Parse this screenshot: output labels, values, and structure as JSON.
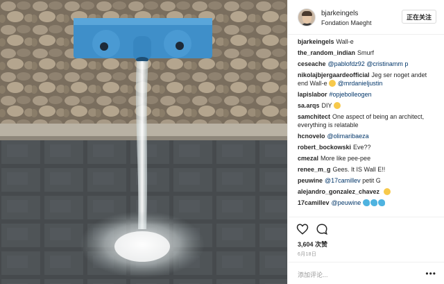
{
  "post_header": {
    "username": "bjarkeingels",
    "location": "Fondation Maeght",
    "follow_label": "正在关注"
  },
  "comments": [
    {
      "user": "bjarkeingels",
      "text": "Wall-e"
    },
    {
      "user": "the_random_indian",
      "text": "Smurf"
    },
    {
      "user": "ceseache",
      "text": "",
      "mentions": "@pablofdz92 @cristinamm p"
    },
    {
      "user": "nikolajbjergaardeofficial",
      "text": "Jeg ser noget andet end Wall-e",
      "mentions": "@mrdanieljustin"
    },
    {
      "user": "lapislabor",
      "text": "",
      "mentions": "#opjebolleogen"
    },
    {
      "user": "sa.arqs",
      "text": "DIY"
    },
    {
      "user": "samchitect",
      "text": "One aspect of being an architect, everything is relatable"
    },
    {
      "user": "hcnovelo",
      "text": "",
      "mentions": "@olimaribaeza"
    },
    {
      "user": "robert_bockowski",
      "text": "Eve??"
    },
    {
      "user": "cmezal",
      "text": "More like pee-pee"
    },
    {
      "user": "renee_m_g",
      "text": "Gees. It IS Wall E!!"
    },
    {
      "user": "peuwine",
      "text": "petit G",
      "mentions": "@17camillev"
    },
    {
      "user": "alejandro_gonzalez_chavez",
      "text": ""
    },
    {
      "user": "17camillev",
      "text": "",
      "mentions": "@peuwine"
    }
  ],
  "actions": {
    "likes": "3,604 次赞",
    "date": "6月18日",
    "add_comment_placeholder": "添加评论...",
    "more_label": "•••"
  },
  "icons": {
    "like": "heart-icon",
    "comment": "comment-icon",
    "more": "more-options-icon"
  }
}
